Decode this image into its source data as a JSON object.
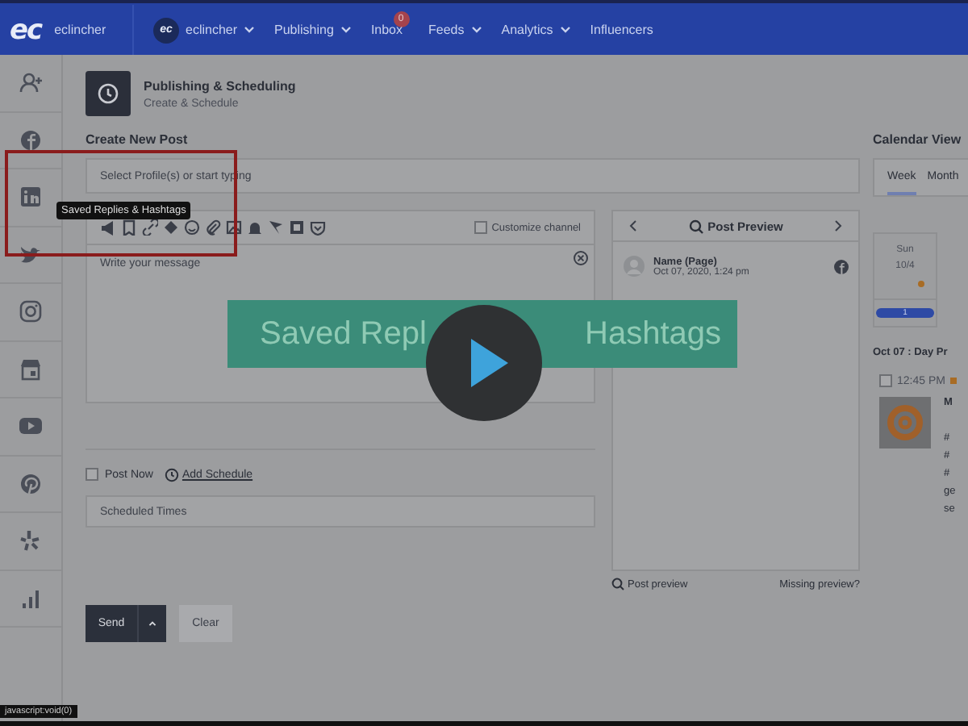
{
  "nav": {
    "logo_mark": "ec",
    "logo_text": "eclincher",
    "items": [
      {
        "label": "eclincher",
        "kind": "account",
        "avatar": "ec",
        "dropdown": true
      },
      {
        "label": "Publishing",
        "kind": "menu",
        "dropdown": true
      },
      {
        "label": "Inbox",
        "kind": "menu",
        "dropdown": false,
        "badge": "0"
      },
      {
        "label": "Feeds",
        "kind": "menu",
        "dropdown": true
      },
      {
        "label": "Analytics",
        "kind": "menu",
        "dropdown": true
      },
      {
        "label": "Influencers",
        "kind": "menu",
        "dropdown": false
      }
    ]
  },
  "header": {
    "title": "Publishing & Scheduling",
    "subtitle": "Create & Schedule"
  },
  "composer": {
    "title": "Create New Post",
    "profile_placeholder": "Select Profile(s) or start typing",
    "tooltip": "Saved Replies & Hashtags",
    "customize_channel": {
      "label": "Customize channel",
      "checked": false
    },
    "message_placeholder": "Write your message",
    "post_now": {
      "label": "Post Now",
      "checked": false
    },
    "add_schedule": "Add Schedule",
    "scheduled_placeholder": "Scheduled Times",
    "send": "Send",
    "clear": "Clear"
  },
  "preview": {
    "title": "Post Preview",
    "name": "Name (Page)",
    "date": "Oct 07, 2020, 1:24 pm",
    "footer_left": "Post preview",
    "footer_right": "Missing preview?"
  },
  "calendar": {
    "title": "Calendar View",
    "tabs": [
      {
        "label": "Week",
        "selected": true
      },
      {
        "label": "Month",
        "selected": false
      }
    ],
    "day": {
      "name": "Sun",
      "date": "10/4"
    },
    "count": "1",
    "day_preview": "Oct 07 : Day Pr",
    "post": {
      "time": "12:45 PM",
      "checked": false,
      "lines": [
        "M",
        "#",
        "#",
        "#",
        "ge",
        "se"
      ]
    }
  },
  "video": {
    "banner_left": "Saved Repl",
    "banner_right": "Hashtags"
  },
  "status_bar": "javascript:void(0)"
}
